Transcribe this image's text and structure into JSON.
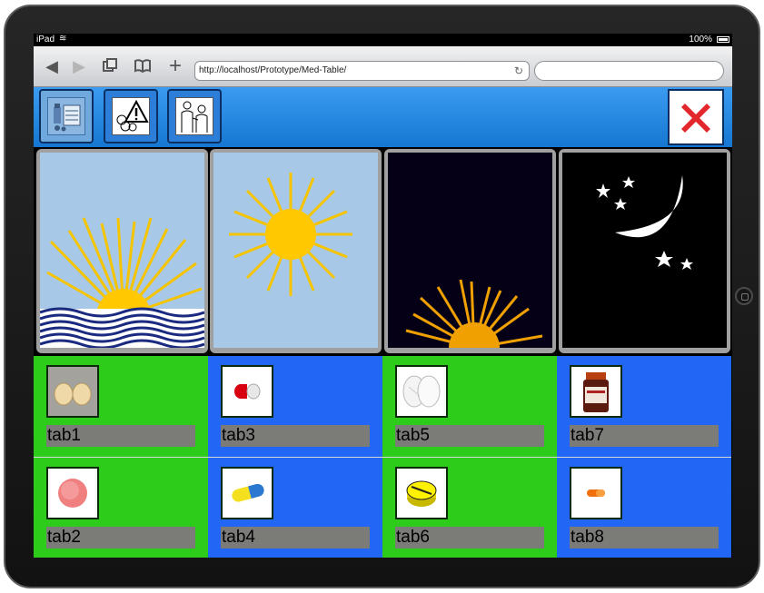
{
  "statusbar": {
    "device_name": "iPad",
    "battery": "100%"
  },
  "browser": {
    "url": "http://localhost/Prototype/Med-Table/",
    "back_icon": "back-arrow-icon",
    "forward_icon": "forward-arrow-icon"
  },
  "header": {
    "buttons": [
      {
        "icon": "medication-schedule-icon",
        "active": true
      },
      {
        "icon": "warning-allergy-icon",
        "active": false
      },
      {
        "icon": "doctor-patient-icon",
        "active": false
      }
    ],
    "close_icon": "close-x-icon"
  },
  "time_slots": [
    {
      "name": "morning",
      "icon": "sunrise-over-sea-icon"
    },
    {
      "name": "noon",
      "icon": "sun-icon"
    },
    {
      "name": "evening",
      "icon": "sunset-icon"
    },
    {
      "name": "night",
      "icon": "moon-stars-icon"
    }
  ],
  "medications": {
    "row1": [
      {
        "label": "tab1",
        "icon": "beige-tablets-icon"
      },
      {
        "label": "tab3",
        "icon": "red-white-capsule-icon"
      },
      {
        "label": "tab5",
        "icon": "white-oval-tablets-icon"
      },
      {
        "label": "tab7",
        "icon": "medicine-bottle-icon"
      }
    ],
    "row2": [
      {
        "label": "tab2",
        "icon": "pink-round-tablet-icon"
      },
      {
        "label": "tab4",
        "icon": "yellow-blue-capsule-icon"
      },
      {
        "label": "tab6",
        "icon": "yellow-disc-tablet-icon"
      },
      {
        "label": "tab8",
        "icon": "orange-capsule-icon"
      }
    ]
  },
  "colors": {
    "cell_green": "#2ecc1a",
    "cell_blue": "#2266f5",
    "header_blue": "#1f86e0",
    "close_red": "#e2282c"
  }
}
